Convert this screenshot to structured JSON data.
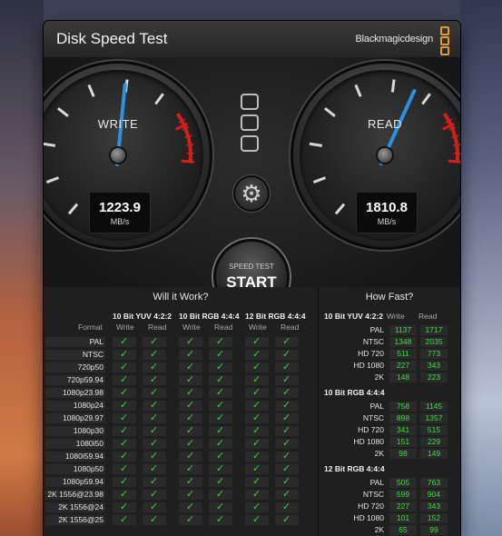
{
  "window": {
    "title": "Disk Speed Test",
    "brand": "Blackmagicdesign"
  },
  "gauges": {
    "write": {
      "label": "WRITE",
      "value": "1223.9",
      "unit": "MB/s",
      "fraction": 0.62
    },
    "read": {
      "label": "READ",
      "value": "1810.8",
      "unit": "MB/s",
      "fraction": 0.7
    }
  },
  "controls": {
    "start_small": "SPEED TEST",
    "start_big": "START",
    "settings_icon": "gear-icon"
  },
  "will_it_work": {
    "title": "Will it Work?",
    "format_header": "Format",
    "groups": [
      "10 Bit YUV 4:2:2",
      "10 Bit RGB 4:4:4",
      "12 Bit RGB 4:4:4"
    ],
    "sub_headers": [
      "Write",
      "Read",
      "Write",
      "Read",
      "Write",
      "Read"
    ],
    "formats": [
      "PAL",
      "NTSC",
      "720p50",
      "720p59.94",
      "1080p23.98",
      "1080p24",
      "1080p29.97",
      "1080p30",
      "1080i50",
      "1080i59.94",
      "1080p50",
      "1080p59.94",
      "2K 1556@23.98",
      "2K 1556@24",
      "2K 1556@25"
    ]
  },
  "how_fast": {
    "title": "How Fast?",
    "col_write": "Write",
    "col_read": "Read",
    "groups": [
      {
        "name": "10 Bit YUV 4:2:2",
        "rows": [
          {
            "label": "PAL",
            "write": "1137",
            "read": "1717"
          },
          {
            "label": "NTSC",
            "write": "1348",
            "read": "2035"
          },
          {
            "label": "HD 720",
            "write": "511",
            "read": "773"
          },
          {
            "label": "HD 1080",
            "write": "227",
            "read": "343"
          },
          {
            "label": "2K",
            "write": "148",
            "read": "223"
          }
        ]
      },
      {
        "name": "10 Bit RGB 4:4:4",
        "rows": [
          {
            "label": "PAL",
            "write": "758",
            "read": "1145"
          },
          {
            "label": "NTSC",
            "write": "898",
            "read": "1357"
          },
          {
            "label": "HD 720",
            "write": "341",
            "read": "515"
          },
          {
            "label": "HD 1080",
            "write": "151",
            "read": "229"
          },
          {
            "label": "2K",
            "write": "98",
            "read": "149"
          }
        ]
      },
      {
        "name": "12 Bit RGB 4:4:4",
        "rows": [
          {
            "label": "PAL",
            "write": "505",
            "read": "763"
          },
          {
            "label": "NTSC",
            "write": "599",
            "read": "904"
          },
          {
            "label": "HD 720",
            "write": "227",
            "read": "343"
          },
          {
            "label": "HD 1080",
            "write": "101",
            "read": "152"
          },
          {
            "label": "2K",
            "write": "65",
            "read": "99"
          }
        ]
      }
    ]
  },
  "colors": {
    "ok": "#3fcf3f",
    "redzone": "#d0201a",
    "needle": "#2f8fe0",
    "brand_orange": "#e49a2c"
  }
}
